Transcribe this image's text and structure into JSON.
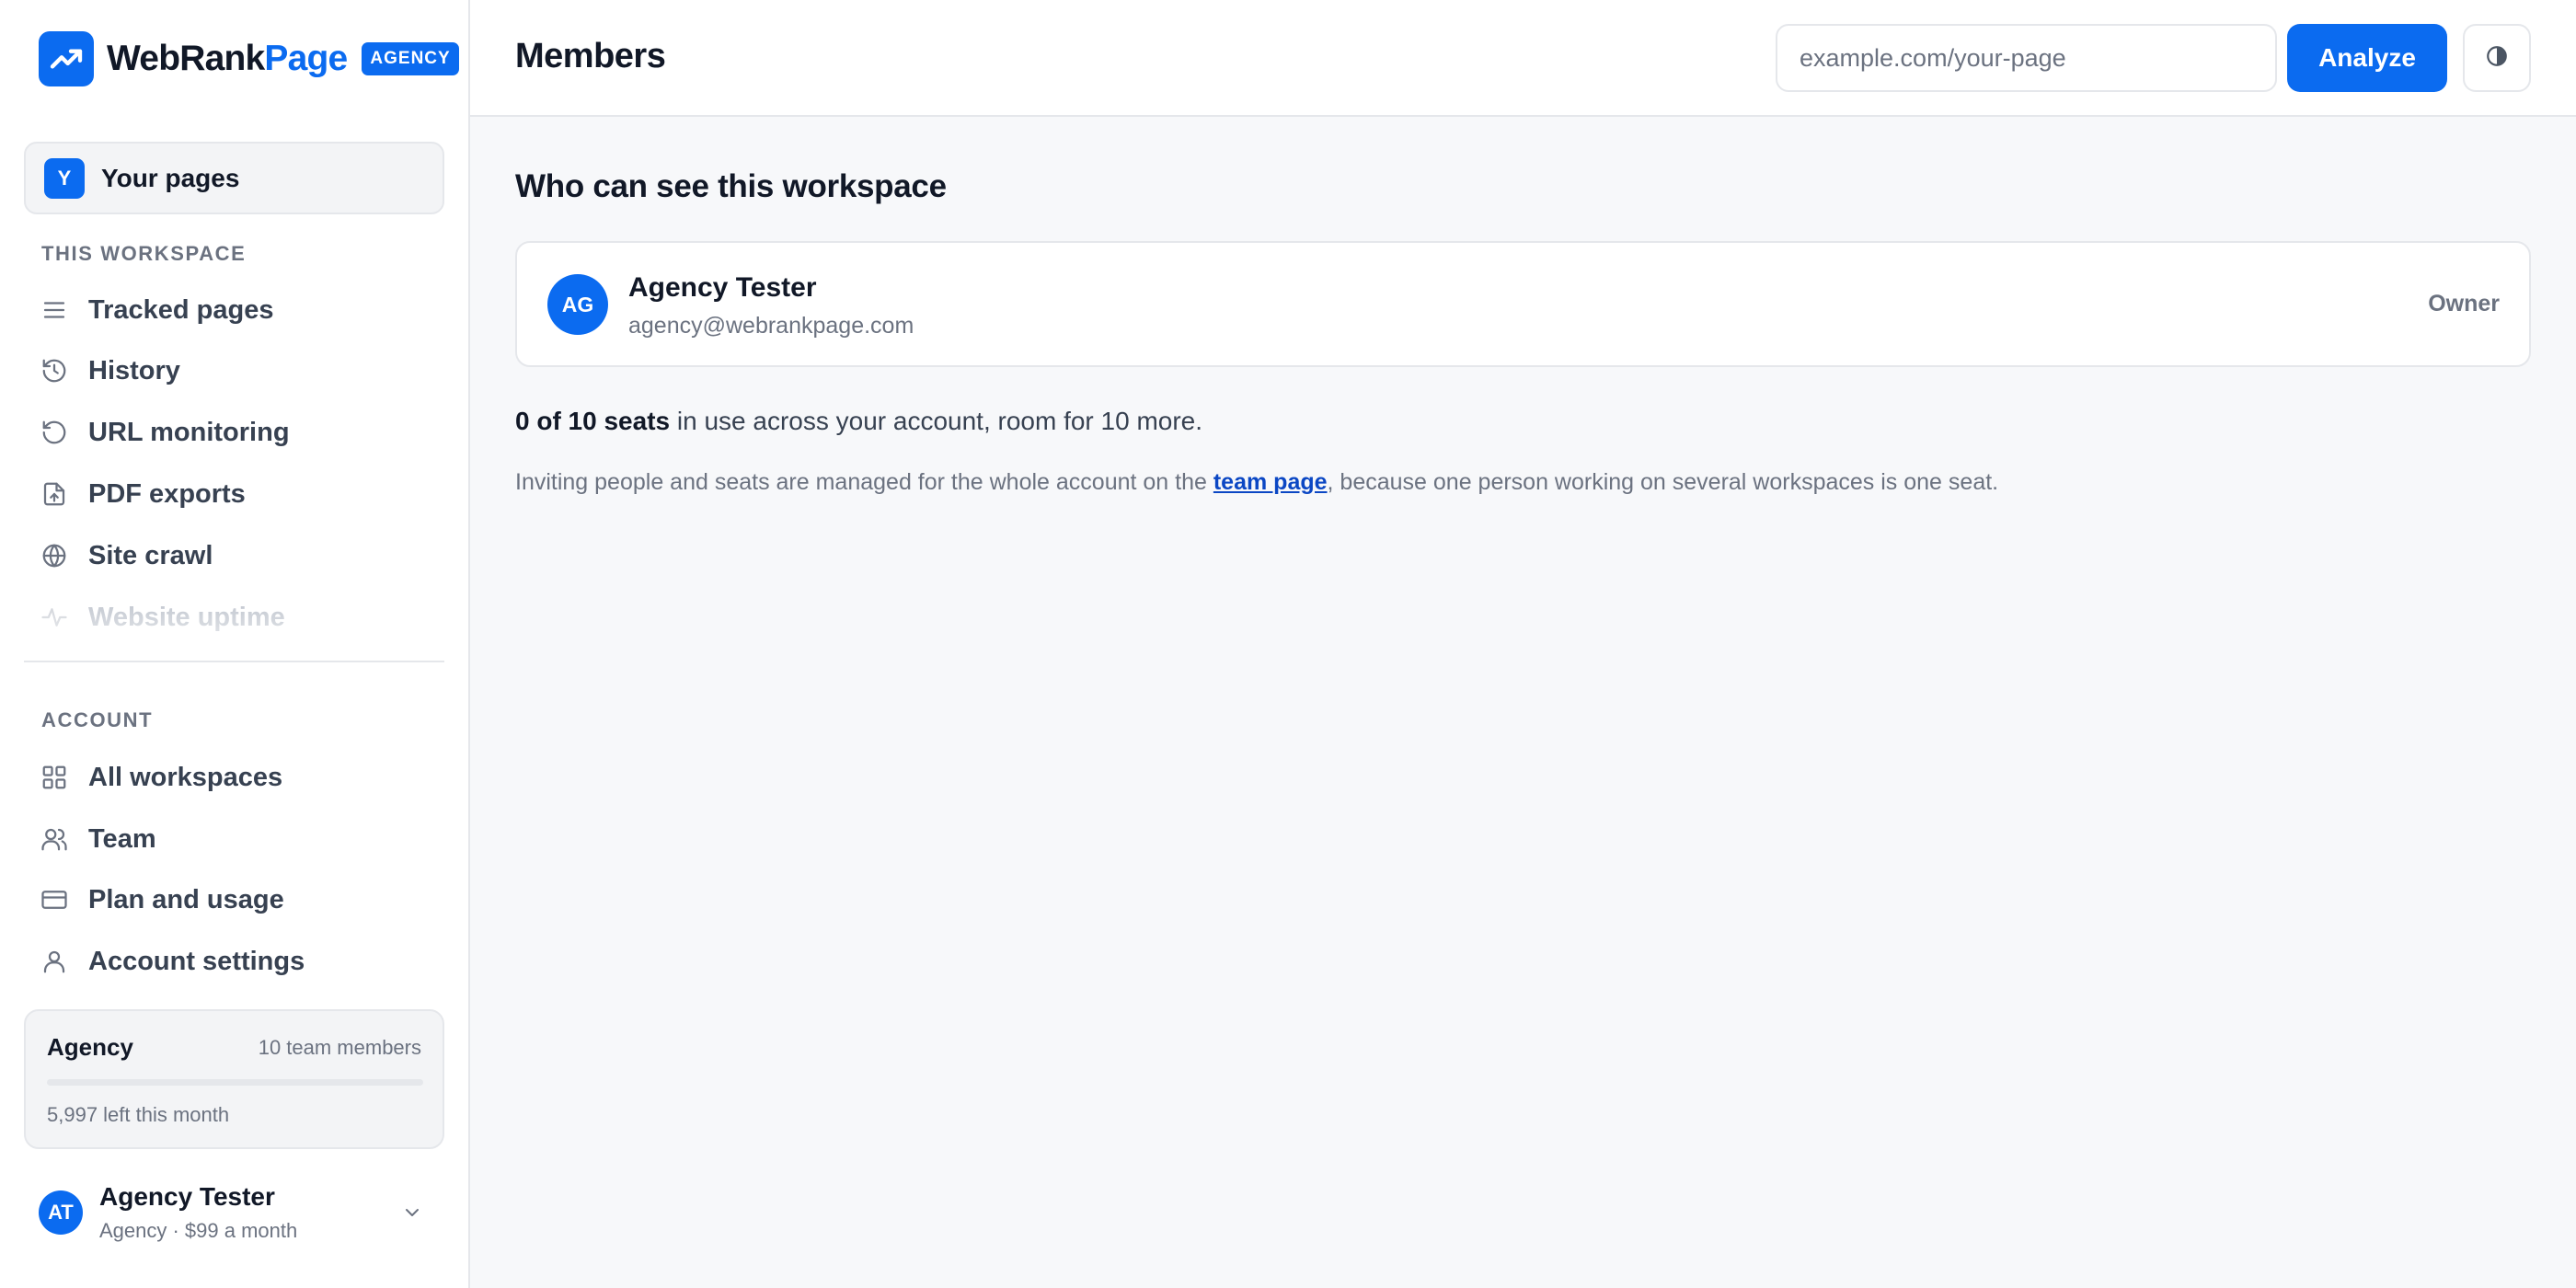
{
  "brand": {
    "name_part1": "WebRank",
    "name_part2": "Page",
    "badge": "AGENCY",
    "accent_color": "#0b6bf0"
  },
  "sidebar": {
    "your_pages": {
      "avatar_letter": "Y",
      "label": "Your pages"
    },
    "workspace_section": {
      "label": "THIS WORKSPACE",
      "items": [
        {
          "label": "Tracked pages",
          "icon": "list-icon"
        },
        {
          "label": "History",
          "icon": "history-icon"
        },
        {
          "label": "URL monitoring",
          "icon": "refresh-icon"
        },
        {
          "label": "PDF exports",
          "icon": "file-export-icon"
        },
        {
          "label": "Site crawl",
          "icon": "globe-icon"
        },
        {
          "label": "Website uptime",
          "icon": "activity-icon"
        }
      ]
    },
    "account_section": {
      "label": "ACCOUNT",
      "items": [
        {
          "label": "All workspaces",
          "icon": "grid-icon"
        },
        {
          "label": "Team",
          "icon": "users-icon"
        },
        {
          "label": "Plan and usage",
          "icon": "credit-card-icon"
        },
        {
          "label": "Account settings",
          "icon": "user-icon"
        }
      ]
    },
    "plan": {
      "name": "Agency",
      "members": "10 team members",
      "usage_fraction": 0.0,
      "left": "5,997 left this month"
    },
    "user": {
      "initials": "AT",
      "name": "Agency Tester",
      "subtitle": "Agency · $99 a month"
    }
  },
  "header": {
    "title": "Members",
    "search_placeholder": "example.com/your-page",
    "analyze_label": "Analyze"
  },
  "main": {
    "section_title": "Who can see this workspace",
    "member": {
      "initials": "AG",
      "name": "Agency Tester",
      "email": "agency@webrankpage.com",
      "role": "Owner"
    },
    "seats": {
      "bold": "0 of 10 seats",
      "rest": " in use across your account, room for 10 more."
    },
    "info": {
      "before": "Inviting people and seats are managed for the whole account on the ",
      "link": "team page",
      "after": ", because one person working on several workspaces is one seat."
    }
  }
}
